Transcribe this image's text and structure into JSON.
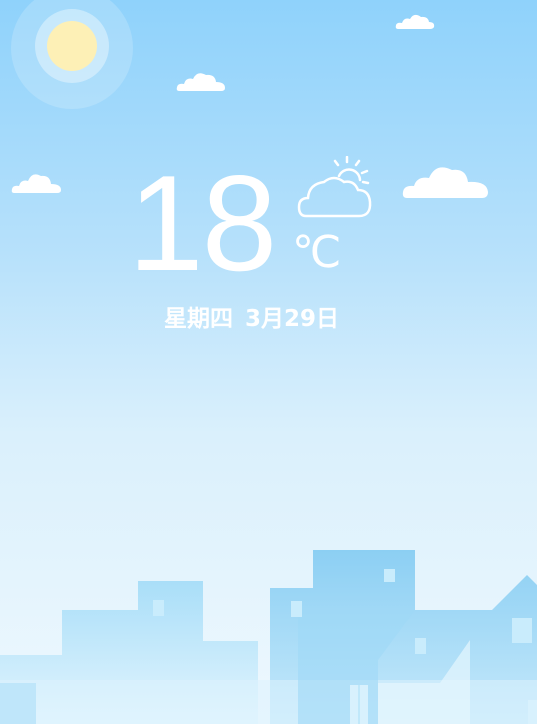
{
  "weather": {
    "temperature": "18",
    "unit": "℃",
    "condition_icon": "partly-cloudy-sun-icon",
    "weekday": "星期四",
    "date": "3月29日"
  },
  "scene": {
    "sun_icon": "sun-icon",
    "cloud_icon": "cloud-icon",
    "skyline": "city-skyline-illustration"
  },
  "colors": {
    "sky_top": "#8fd2fb",
    "sky_bottom": "#eef8fe",
    "sun": "#fdf0b6",
    "text": "#ffffff",
    "building_dark": "#7cc7ef",
    "building_light": "#a7dcf7"
  }
}
